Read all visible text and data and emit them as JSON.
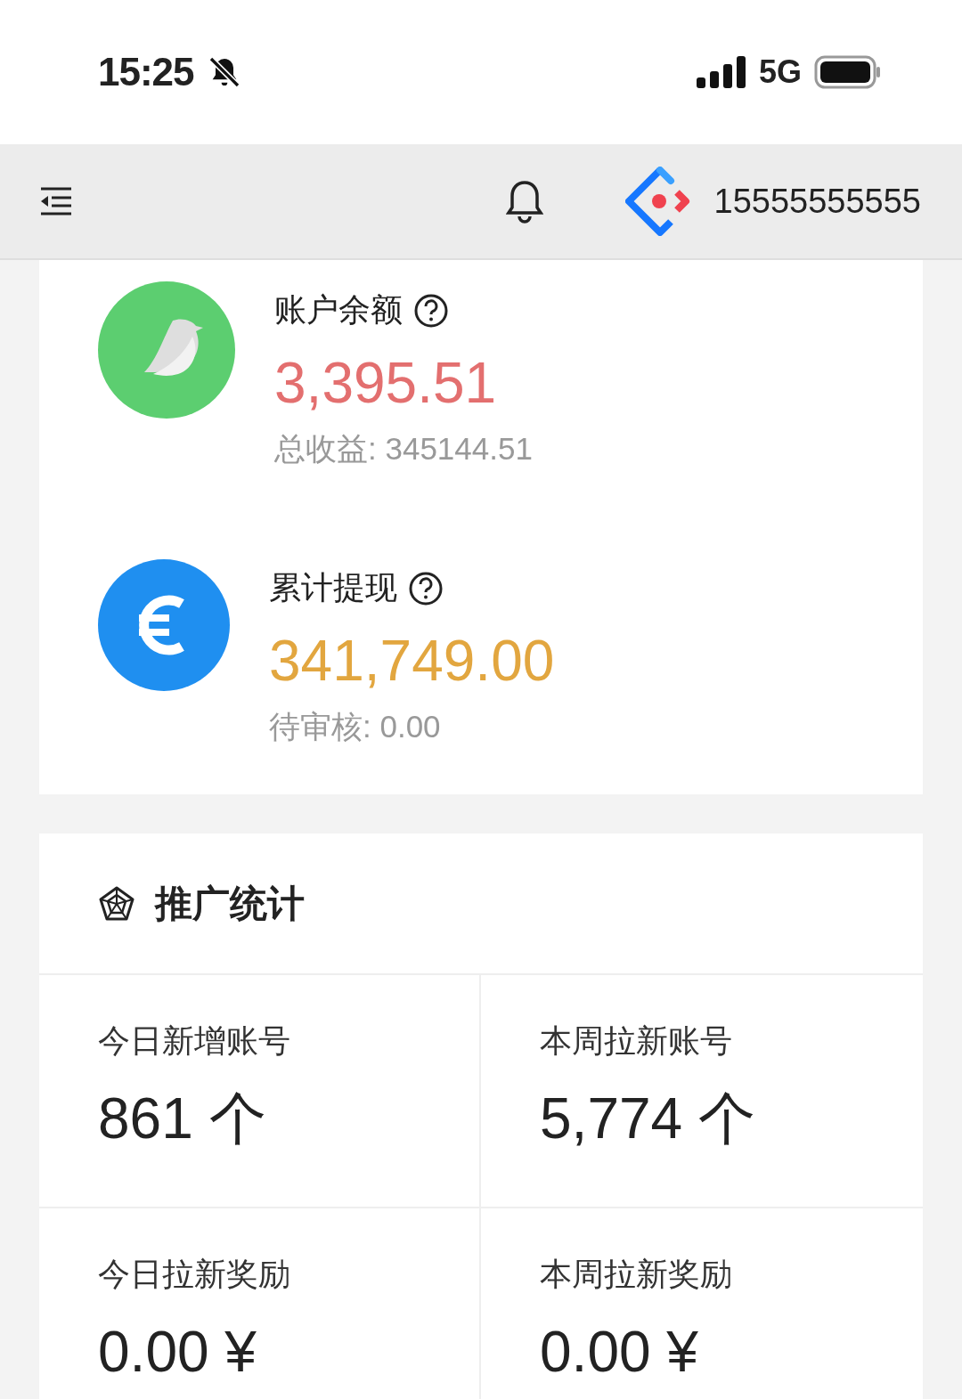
{
  "status_bar": {
    "time": "15:25",
    "network": "5G"
  },
  "header": {
    "account": "15555555555"
  },
  "balances": [
    {
      "kind": "balance",
      "label": "账户余额",
      "amount": "3,395.51",
      "color": "#e36f6f",
      "note": "总收益: 345144.51"
    },
    {
      "kind": "withdrawn",
      "label": "累计提现",
      "amount": "341,749.00",
      "color": "#e2a63f",
      "note": "待审核: 0.00"
    }
  ],
  "stats": {
    "title": "推广统计",
    "cells": [
      {
        "label": "今日新增账号",
        "value": "861 个"
      },
      {
        "label": "本周拉新账号",
        "value": "5,774 个"
      },
      {
        "label": "今日拉新奖励",
        "value": "0.00 ¥"
      },
      {
        "label": "本周拉新奖励",
        "value": "0.00 ¥"
      }
    ]
  }
}
